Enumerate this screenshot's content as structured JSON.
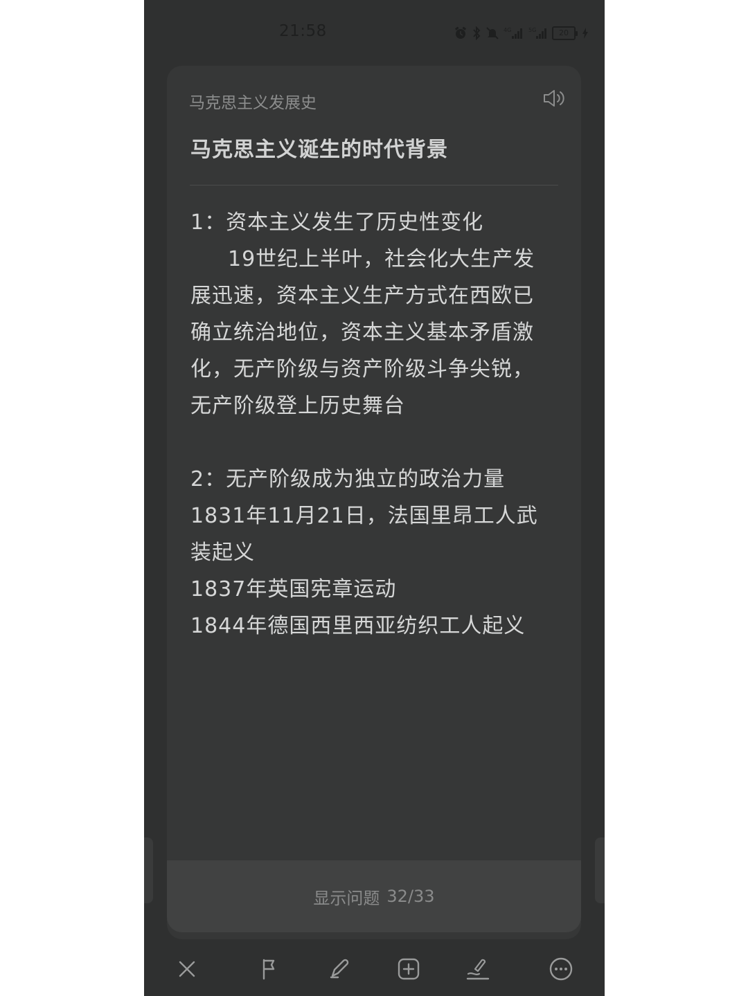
{
  "status_bar": {
    "time": "21:58",
    "battery_level": "20",
    "icons": [
      "alarm-icon",
      "bluetooth-icon",
      "mute-icon",
      "signal-4g-icon",
      "signal-5g-icon",
      "battery-icon",
      "charging-icon"
    ]
  },
  "card": {
    "subject": "马克思主义发展史",
    "title": "马克思主义诞生的时代背景",
    "body_lines": [
      "1：资本主义发生了历史性变化",
      "19世纪上半叶，社会化大生产发",
      "展迅速，资本主义生产方式在西欧已",
      "确立统治地位，资本主义基本矛盾激",
      "化，无产阶级与资产阶级斗争尖锐，",
      "无产阶级登上历史舞台",
      "",
      "2：无产阶级成为独立的政治力量",
      "1831年11月21日，法国里昂工人武",
      "装起义",
      "1837年英国宪章运动",
      "1844年德国西里西亚纺织工人起义"
    ]
  },
  "show_question": {
    "label": "显示问题",
    "progress": "32/33"
  },
  "toolbar": {
    "items": [
      "close-icon",
      "flag-icon",
      "edit-icon",
      "add-card-icon",
      "sign-icon",
      "more-icon"
    ]
  },
  "colors": {
    "background": "#2f3030",
    "card": "#363737",
    "text": "#d6d7d7",
    "muted": "#8c8d8d"
  }
}
